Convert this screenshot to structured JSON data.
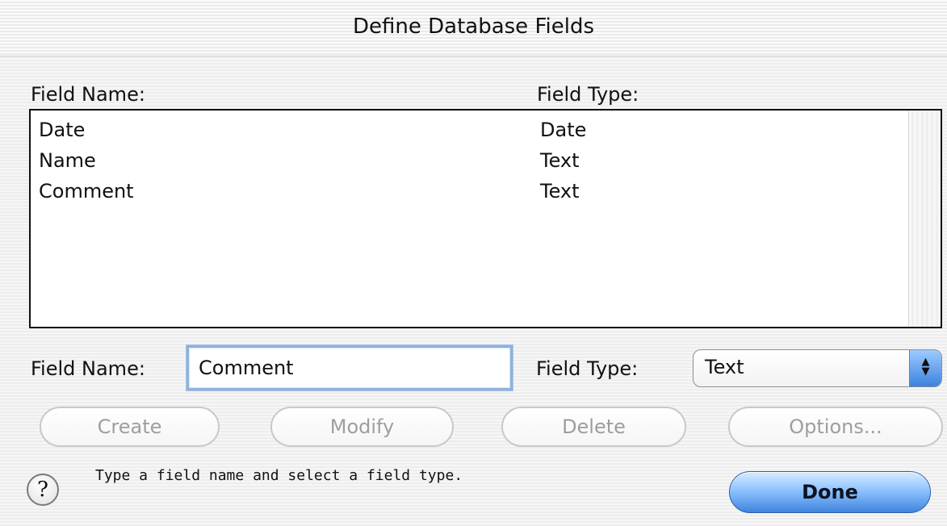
{
  "window": {
    "title": "Define Database Fields"
  },
  "list": {
    "headers": {
      "field_name": "Field Name:",
      "field_type": "Field Type:"
    },
    "rows": [
      {
        "name": "Date",
        "type": "Date"
      },
      {
        "name": "Name",
        "type": "Text"
      },
      {
        "name": "Comment",
        "type": "Text"
      }
    ]
  },
  "editor": {
    "field_name_label": "Field Name:",
    "field_name_value": "Comment",
    "field_type_label": "Field Type:",
    "field_type_value": "Text"
  },
  "buttons": {
    "create": "Create",
    "modify": "Modify",
    "delete": "Delete",
    "options": "Options...",
    "done": "Done"
  },
  "help": {
    "icon_label": "?",
    "status_text": "Type a field name and select a field type."
  },
  "icons": {
    "popup_arrows": "up-down-arrows-icon",
    "help": "help-icon"
  },
  "colors": {
    "selection_border": "#8fb2dc",
    "default_button": "#3e84de",
    "popup_arrows": "#3c82df"
  }
}
